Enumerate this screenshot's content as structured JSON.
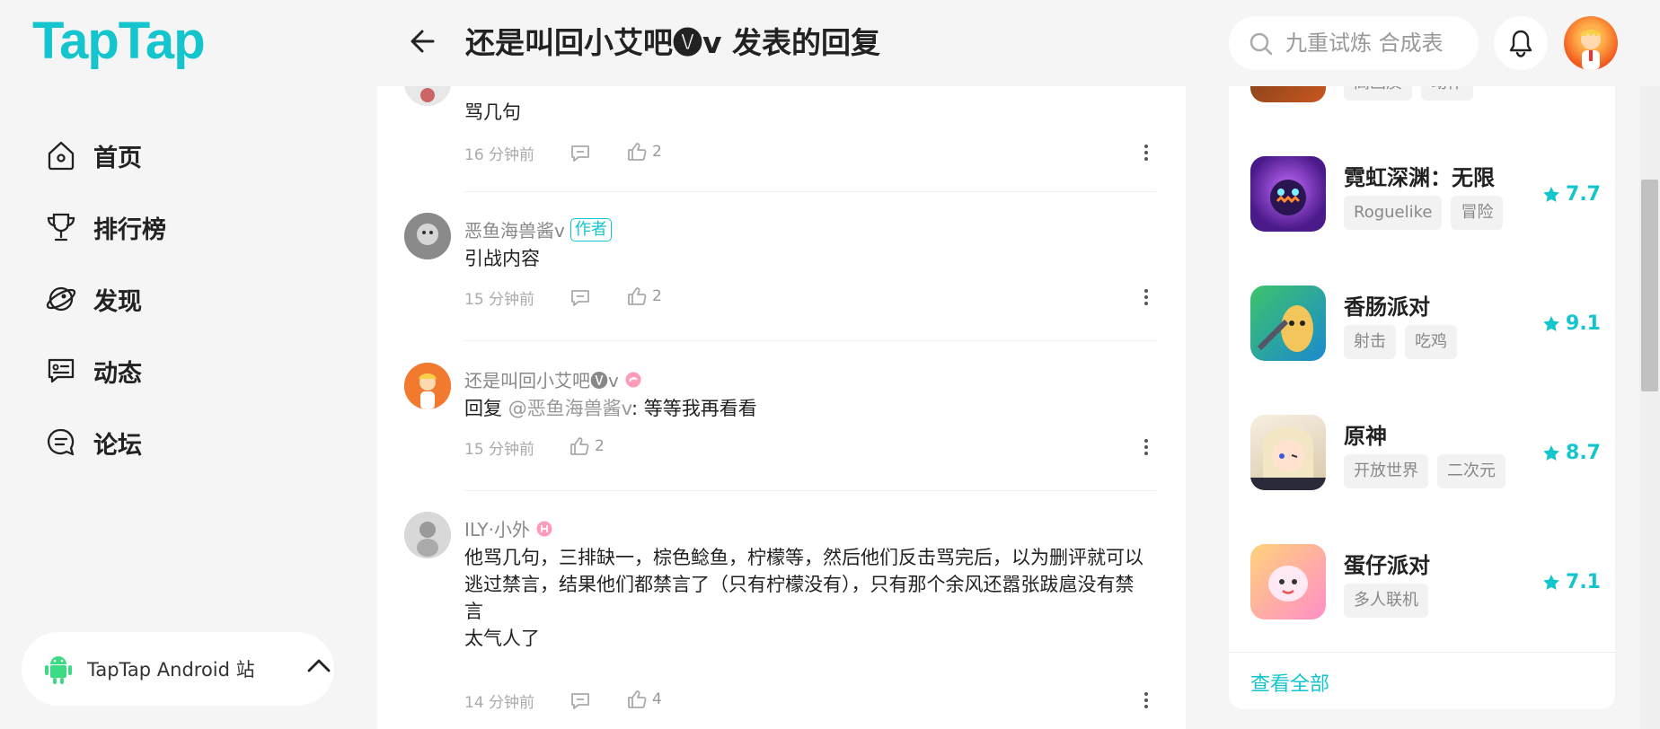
{
  "header": {
    "logo": "TapTap",
    "title": "还是叫回小艾吧🅥v 发表的回复",
    "search_placeholder": "九重试炼 合成表"
  },
  "nav": {
    "items": [
      {
        "label": "首页",
        "icon": "home-icon"
      },
      {
        "label": "排行榜",
        "icon": "trophy-icon"
      },
      {
        "label": "发现",
        "icon": "discover-icon"
      },
      {
        "label": "动态",
        "icon": "feed-icon"
      },
      {
        "label": "论坛",
        "icon": "forum-icon"
      }
    ],
    "site_switch": "TapTap Android 站"
  },
  "comments": [
    {
      "user": "",
      "text": "骂几句",
      "time": "16 分钟前",
      "likes": "2"
    },
    {
      "user": "恶鱼海兽酱v",
      "badge": "作者",
      "text": "引战内容",
      "time": "15 分钟前",
      "likes": "2"
    },
    {
      "user": "还是叫回小艾吧🅥v",
      "text_prefix": "回复",
      "mention": "@恶鱼海兽酱v",
      "text_suffix": ": 等等我再看看",
      "time": "15 分钟前",
      "likes": "2"
    },
    {
      "user": "ILY·小外",
      "text_lines": [
        "他骂几句，三排缺一，棕色鲶鱼，柠檬等，然后他们反击骂完后，以为删评就可以",
        "逃过禁言，结果他们都禁言了（只有柠檬没有），只有那个余风还嚣张跋扈没有禁",
        "言",
        "太气人了"
      ],
      "time": "14 分钟前",
      "likes": "4"
    }
  ],
  "sidebar": {
    "partial_tags": [
      "高画质",
      "动作"
    ],
    "games": [
      {
        "name": "霓虹深渊：无限",
        "tags": [
          "Roguelike",
          "冒险"
        ],
        "score": "7.7"
      },
      {
        "name": "香肠派对",
        "tags": [
          "射击",
          "吃鸡"
        ],
        "score": "9.1"
      },
      {
        "name": "原神",
        "tags": [
          "开放世界",
          "二次元"
        ],
        "score": "8.7"
      },
      {
        "name": "蛋仔派对",
        "tags": [
          "多人联机"
        ],
        "score": "7.1"
      }
    ],
    "see_all": "查看全部"
  },
  "colors": {
    "brand": "#15c5ce",
    "background": "#f5f5f5"
  }
}
